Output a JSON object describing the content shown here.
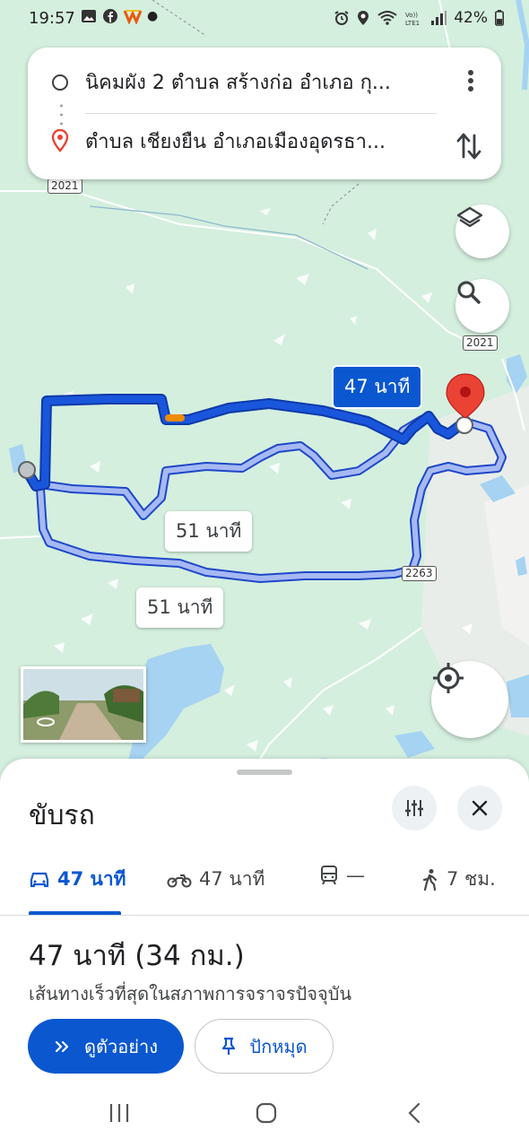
{
  "status_bar": {
    "time": "19:57",
    "battery": "42%",
    "icons": [
      "gallery-icon",
      "facebook-icon",
      "app-icon",
      "dot-icon",
      "alarm-icon",
      "location-icon",
      "wifi-icon",
      "volte-icon",
      "signal-icon",
      "battery-icon"
    ]
  },
  "directions": {
    "origin": "นิคมผัง 2 ตำบล สร้างก่อ อำเภอ กุ...",
    "destination": "ตำบล เชียงยืน อำเภอเมืองอุดรธา..."
  },
  "map": {
    "route_main_label": "47 นาที",
    "route_alt1_label": "51 นาที",
    "route_alt2_label": "51 นาที",
    "road_shields": [
      "2021",
      "2021",
      "2263"
    ],
    "colors": {
      "route_main": "#1a56db",
      "route_alt": "#a6b9f2",
      "water": "#a6d3f2",
      "land": "#d5f0df",
      "pin": "#ea4335"
    }
  },
  "sheet": {
    "title": "ขับรถ",
    "tabs": [
      {
        "icon": "car-icon",
        "label": "47 นาที"
      },
      {
        "icon": "motorcycle-icon",
        "label": "47 นาที"
      },
      {
        "icon": "train-icon",
        "label": "—"
      },
      {
        "icon": "walk-icon",
        "label": "7 ชม."
      }
    ],
    "summary": "47 นาที (34 กม.)",
    "description": "เส้นทางเร็วที่สุดในสภาพการจราจรปัจจุบัน",
    "preview_label": "ดูตัวอย่าง",
    "pin_label": "ปักหมุด"
  }
}
